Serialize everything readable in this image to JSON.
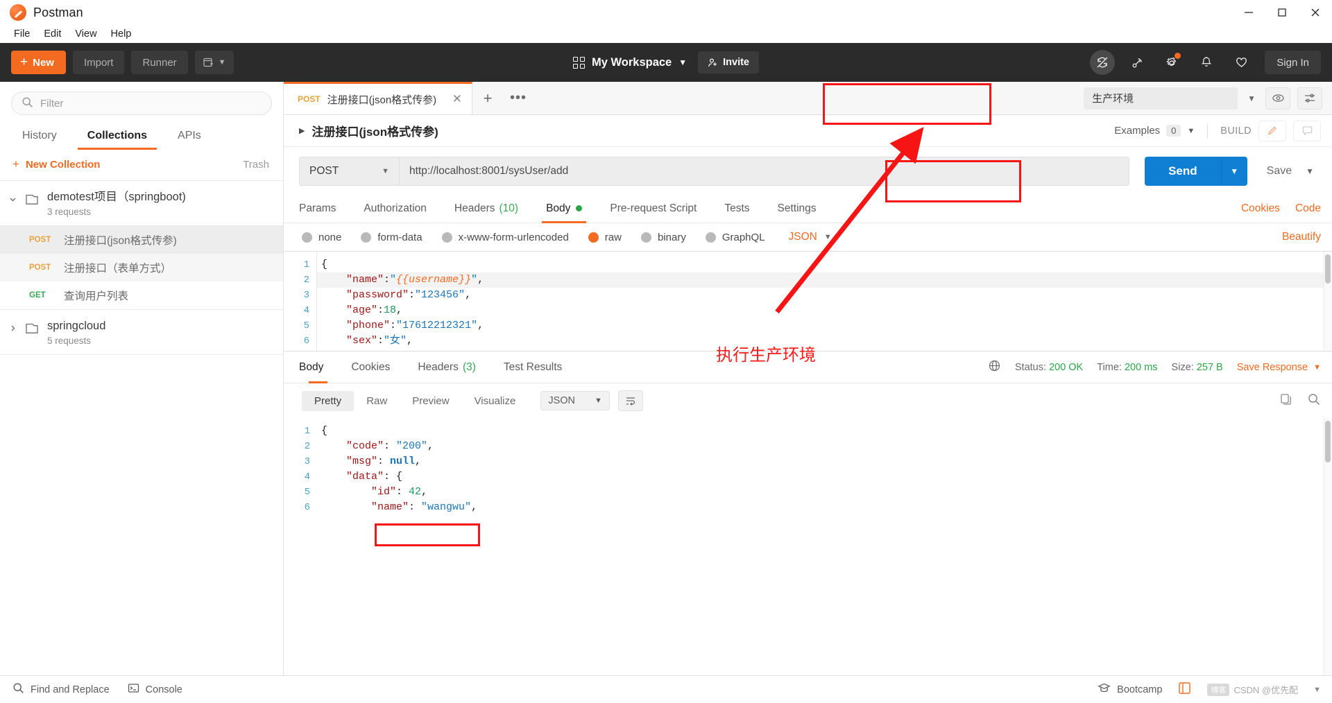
{
  "window": {
    "title": "Postman",
    "logo_icon": "postman-logo-icon",
    "minimize_icon": "minimize-icon",
    "maximize_icon": "maximize-icon",
    "close_icon": "close-icon"
  },
  "menubar": {
    "items": [
      "File",
      "Edit",
      "View",
      "Help"
    ]
  },
  "toolbar": {
    "new_label": "New",
    "import_label": "Import",
    "runner_label": "Runner",
    "new_window_icon": "new-window-icon",
    "workspace_label": "My Workspace",
    "workspace_icon": "grid-icon",
    "invite_label": "Invite",
    "invite_icon": "person-add-icon",
    "sync_off_icon": "sync-off-icon",
    "interceptor_icon": "satellite-icon",
    "settings_icon": "gear-icon",
    "notifications_icon": "bell-icon",
    "favorites_icon": "heart-icon",
    "signin_label": "Sign In"
  },
  "sidebar": {
    "filter_placeholder": "Filter",
    "search_icon": "search-icon",
    "tabs": [
      {
        "label": "History",
        "active": false
      },
      {
        "label": "Collections",
        "active": true
      },
      {
        "label": "APIs",
        "active": false
      }
    ],
    "new_collection_label": "New Collection",
    "trash_label": "Trash",
    "collections": [
      {
        "name": "demotest项目（springboot)",
        "requests_label": "3 requests",
        "expanded": true,
        "items": [
          {
            "method": "POST",
            "name": "注册接口(json格式传参)",
            "state": "selected"
          },
          {
            "method": "POST",
            "name": "注册接口（表单方式）",
            "state": "alt"
          },
          {
            "method": "GET",
            "name": "查询用户列表",
            "state": "normal"
          }
        ]
      },
      {
        "name": "springcloud",
        "requests_label": "5 requests",
        "expanded": false,
        "items": []
      }
    ]
  },
  "tabstrip": {
    "open_tab": {
      "method": "POST",
      "name": "注册接口(json格式传参)",
      "close_icon": "close-icon"
    },
    "add_tab_icon": "plus-icon",
    "more_icon": "ellipsis-icon",
    "environment_value": "生产环境",
    "env_caret_icon": "chevron-down-icon",
    "eye_icon": "eye-icon",
    "settings_sliders_icon": "sliders-icon"
  },
  "request": {
    "title": "注册接口(json格式传参)",
    "collapse_icon": "chevron-right-icon",
    "examples_label": "Examples",
    "examples_count": "0",
    "examples_caret_icon": "chevron-down-icon",
    "build_label": "BUILD",
    "edit_icon": "pencil-icon",
    "comment_icon": "comment-icon",
    "method": "POST",
    "method_caret_icon": "chevron-down-icon",
    "url": "http://localhost:8001/sysUser/add",
    "send_label": "Send",
    "send_caret_icon": "chevron-down-icon",
    "save_label": "Save",
    "save_caret_icon": "chevron-down-icon",
    "tabs": [
      {
        "label": "Params",
        "active": false,
        "count": "",
        "dot": false
      },
      {
        "label": "Authorization",
        "active": false,
        "count": "",
        "dot": false
      },
      {
        "label": "Headers",
        "active": false,
        "count": "(10)",
        "dot": false
      },
      {
        "label": "Body",
        "active": true,
        "count": "",
        "dot": true
      },
      {
        "label": "Pre-request Script",
        "active": false,
        "count": "",
        "dot": false
      },
      {
        "label": "Tests",
        "active": false,
        "count": "",
        "dot": false
      },
      {
        "label": "Settings",
        "active": false,
        "count": "",
        "dot": false
      }
    ],
    "cookies_label": "Cookies",
    "code_label": "Code",
    "body_types": [
      {
        "label": "none",
        "selected": false
      },
      {
        "label": "form-data",
        "selected": false
      },
      {
        "label": "x-www-form-urlencoded",
        "selected": false
      },
      {
        "label": "raw",
        "selected": true
      },
      {
        "label": "binary",
        "selected": false
      },
      {
        "label": "GraphQL",
        "selected": false
      }
    ],
    "raw_format": "JSON",
    "raw_format_caret_icon": "chevron-down-icon",
    "beautify_label": "Beautify",
    "body_lines": [
      {
        "no": "1",
        "tokens": [
          {
            "t": "{",
            "c": "p"
          }
        ]
      },
      {
        "no": "2",
        "tokens": [
          {
            "t": "    \"name\"",
            "c": "k"
          },
          {
            "t": ":",
            "c": "p"
          },
          {
            "t": "\"",
            "c": "s"
          },
          {
            "t": "{{username}}",
            "c": "v"
          },
          {
            "t": "\"",
            "c": "s"
          },
          {
            "t": ",",
            "c": "p"
          }
        ]
      },
      {
        "no": "3",
        "tokens": [
          {
            "t": "    \"password\"",
            "c": "k"
          },
          {
            "t": ":",
            "c": "p"
          },
          {
            "t": "\"123456\"",
            "c": "s"
          },
          {
            "t": ",",
            "c": "p"
          }
        ]
      },
      {
        "no": "4",
        "tokens": [
          {
            "t": "    \"age\"",
            "c": "k"
          },
          {
            "t": ":",
            "c": "p"
          },
          {
            "t": "18",
            "c": "n"
          },
          {
            "t": ",",
            "c": "p"
          }
        ]
      },
      {
        "no": "5",
        "tokens": [
          {
            "t": "    \"phone\"",
            "c": "k"
          },
          {
            "t": ":",
            "c": "p"
          },
          {
            "t": "\"17612212321\"",
            "c": "s"
          },
          {
            "t": ",",
            "c": "p"
          }
        ]
      },
      {
        "no": "6",
        "tokens": [
          {
            "t": "    \"sex\"",
            "c": "k"
          },
          {
            "t": ":",
            "c": "p"
          },
          {
            "t": "\"女\"",
            "c": "s"
          },
          {
            "t": ",",
            "c": "p"
          }
        ]
      }
    ]
  },
  "response": {
    "tabs": [
      {
        "label": "Body",
        "active": true,
        "count": ""
      },
      {
        "label": "Cookies",
        "active": false,
        "count": ""
      },
      {
        "label": "Headers",
        "active": false,
        "count": "(3)"
      },
      {
        "label": "Test Results",
        "active": false,
        "count": ""
      }
    ],
    "globe_icon": "globe-icon",
    "status_label": "Status:",
    "status_value": "200 OK",
    "time_label": "Time:",
    "time_value": "200 ms",
    "size_label": "Size:",
    "size_value": "257 B",
    "save_response_label": "Save Response",
    "save_response_caret_icon": "chevron-down-icon",
    "view_modes": [
      {
        "label": "Pretty",
        "active": true
      },
      {
        "label": "Raw",
        "active": false
      },
      {
        "label": "Preview",
        "active": false
      },
      {
        "label": "Visualize",
        "active": false
      }
    ],
    "format": "JSON",
    "format_caret_icon": "chevron-down-icon",
    "wrap_icon": "word-wrap-icon",
    "copy_icon": "copy-icon",
    "search_icon": "search-icon",
    "body_lines": [
      {
        "no": "1",
        "tokens": [
          {
            "t": "{",
            "c": "p"
          }
        ]
      },
      {
        "no": "2",
        "tokens": [
          {
            "t": "    \"code\"",
            "c": "rk"
          },
          {
            "t": ": ",
            "c": "p"
          },
          {
            "t": "\"200\"",
            "c": "rs"
          },
          {
            "t": ",",
            "c": "p"
          }
        ]
      },
      {
        "no": "3",
        "tokens": [
          {
            "t": "    \"msg\"",
            "c": "rk"
          },
          {
            "t": ": ",
            "c": "p"
          },
          {
            "t": "null",
            "c": "rnull"
          },
          {
            "t": ",",
            "c": "p"
          }
        ]
      },
      {
        "no": "4",
        "tokens": [
          {
            "t": "    \"data\"",
            "c": "rk"
          },
          {
            "t": ": {",
            "c": "p"
          }
        ]
      },
      {
        "no": "5",
        "tokens": [
          {
            "t": "        \"id\"",
            "c": "rk"
          },
          {
            "t": ": ",
            "c": "p"
          },
          {
            "t": "42",
            "c": "rn"
          },
          {
            "t": ",",
            "c": "p"
          }
        ]
      },
      {
        "no": "6",
        "tokens": [
          {
            "t": "        \"name\"",
            "c": "rk"
          },
          {
            "t": ": ",
            "c": "p"
          },
          {
            "t": "\"wangwu\"",
            "c": "rs"
          },
          {
            "t": ",",
            "c": "p"
          }
        ]
      }
    ]
  },
  "statusbar": {
    "find_replace_label": "Find and Replace",
    "find_replace_icon": "search-icon",
    "console_label": "Console",
    "console_icon": "terminal-icon",
    "bootcamp_label": "Bootcamp",
    "bootcamp_icon": "graduation-cap-icon",
    "runner_icon": "runner-icon",
    "watermark": "CSDN @优先配",
    "watermark_badge": "博客"
  },
  "annotations": {
    "env_note": "执行生产环境",
    "highlight_color": "#f71414"
  }
}
